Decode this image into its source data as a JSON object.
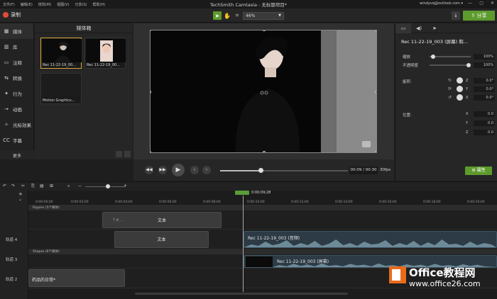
{
  "menubar": {
    "menus": [
      "文件(F)",
      "编辑(E)",
      "修改(M)",
      "视图(V)",
      "分享(S)",
      "帮助(H)"
    ],
    "title": "TechSmith Camtasia - 无标题项目*",
    "account": "windyvq@outlook.com"
  },
  "toolbar": {
    "record_label": "录制",
    "zoom_value": "46%",
    "share_label": "分享"
  },
  "leftnav": {
    "items": [
      {
        "icon": "media-icon",
        "glyph": "▦",
        "label": "媒体"
      },
      {
        "icon": "library-icon",
        "glyph": "▥",
        "label": "库"
      },
      {
        "icon": "annotations-icon",
        "glyph": "▭",
        "label": "注释"
      },
      {
        "icon": "transitions-icon",
        "glyph": "⇆",
        "label": "转换"
      },
      {
        "icon": "behaviors-icon",
        "glyph": "✦",
        "label": "行为"
      },
      {
        "icon": "animations-icon",
        "glyph": "→",
        "label": "动画"
      },
      {
        "icon": "cursor-effects-icon",
        "glyph": "✧",
        "label": "光标效果"
      },
      {
        "icon": "captions-icon",
        "glyph": "CC",
        "label": "字幕"
      }
    ],
    "more_label": "更多"
  },
  "mediabin": {
    "title": "媒体箱",
    "items": [
      {
        "caption": "Rec 11-22-19_00..."
      },
      {
        "caption": "Rec 11-22-19_00..."
      },
      {
        "caption": "Motion Graphics..."
      }
    ]
  },
  "playback": {
    "timecode": "00:09 / 00:30",
    "fps": "30fps",
    "progress": 0.3
  },
  "properties": {
    "title": "Rec 11-22-19_003 (屏幕) 和...",
    "scale_label": "缩放",
    "scale_value": "100%",
    "opacity_label": "不透明度",
    "opacity_value": "100%",
    "rotation_label": "旋转:",
    "rot_z": "0.0°",
    "rot_y": "0.0°",
    "rot_x": "0.0°",
    "position_label": "位置:",
    "pos_x": "0.0",
    "pos_y": "0.0",
    "pos_z": "0.0",
    "axis_x": "X",
    "axis_y": "Y",
    "axis_z": "Z",
    "button_label": "属性"
  },
  "timeline": {
    "playhead": "0:00:09;28",
    "ticks": [
      "0:00:00;00",
      "0:00:02;00",
      "0:00:04;00",
      "0:00:06;00",
      "0:00:08;00",
      "0:00:10;00",
      "0:00:12;00",
      "0:00:14;00",
      "0:00:16;00",
      "0:00:18;00",
      "0:00:20;00"
    ],
    "group1": "Ripples (5个媒体)",
    "group2": "Shapes (6个媒体)",
    "text_clip_1": "文本",
    "text_clip_1_prefix": "T 文 ...",
    "text_clip_2": "文本",
    "tracks": [
      "轨道 4",
      "轨道 3",
      "轨道 2"
    ],
    "audio_clip": "Rec 11-22-19_003 (音频)",
    "video_clip": "Rec 11-22-19_003 (屏幕)",
    "track2_clip": "药品的日常*"
  },
  "watermark": {
    "name": "Office教程网",
    "url": "www.office26.com"
  },
  "colors": {
    "accent_green": "#5d9b2d",
    "record_red": "#e24a3a",
    "selection_gold": "#d6a53a"
  }
}
